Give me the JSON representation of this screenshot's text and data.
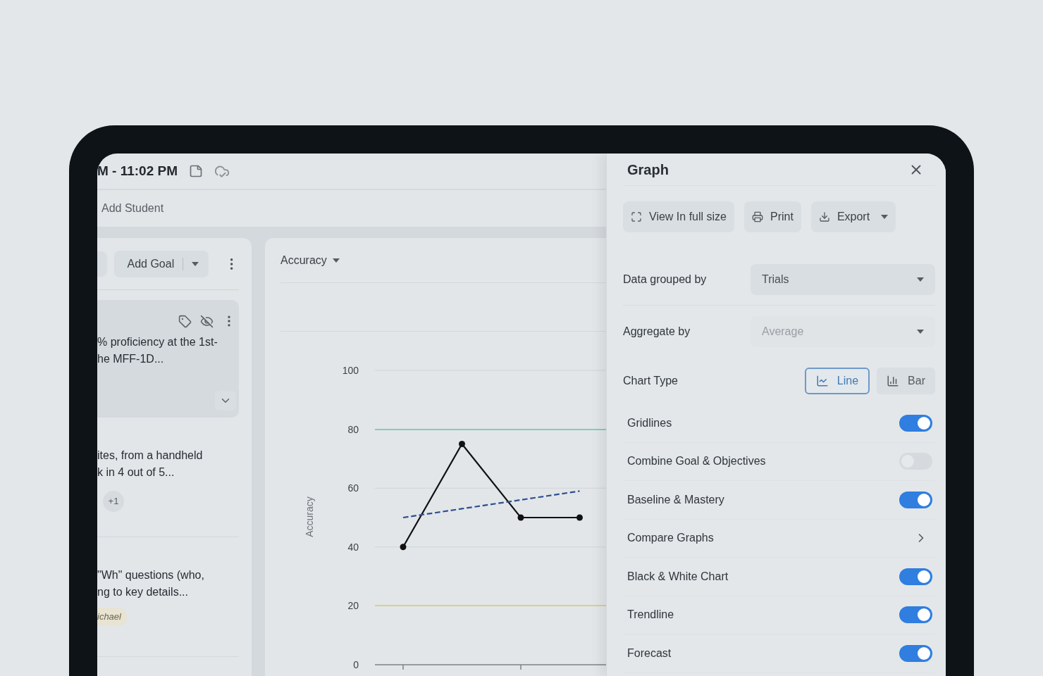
{
  "top_bar": {
    "time": "M - 11:02 PM"
  },
  "sub_bar": {
    "add_student": "Add Student"
  },
  "goals_panel": {
    "add_goal": "Add Goal",
    "goals": [
      {
        "lines": [
          "% proficiency at the 1st-",
          "he MFF-1D..."
        ],
        "selected": true
      },
      {
        "lines": [
          "ites, from a handheld",
          "k in 4 out of 5..."
        ],
        "selected": false,
        "chip": {
          "text": "+1",
          "kind": "count"
        }
      },
      {
        "lines": [
          "\"Wh\" questions (who,",
          "ng to key details..."
        ],
        "selected": false,
        "chip": {
          "text": "ichael",
          "kind": "name"
        }
      }
    ]
  },
  "chart": {
    "metric": "Accuracy",
    "chart_data": {
      "type": "line",
      "ylabel": "Accuracy",
      "ylim": [
        0,
        100
      ],
      "yticks": [
        0,
        20,
        40,
        60,
        80,
        100
      ],
      "series": [
        {
          "color": "#111111",
          "values": [
            40,
            75,
            50,
            50
          ],
          "marker": "circle"
        },
        {
          "color": "#2f4f8f",
          "values": [
            50,
            53,
            56,
            59
          ],
          "line_style": "dashed"
        }
      ],
      "ref_lines": [
        {
          "axis": "y",
          "value": 80,
          "color": "#86cdb6"
        },
        {
          "axis": "y",
          "value": 20,
          "color": "#d9cf8e"
        }
      ]
    }
  },
  "graph_panel": {
    "title": "Graph",
    "actions": [
      {
        "label": "View In full size",
        "kind": "expand"
      },
      {
        "label": "Print",
        "kind": "print"
      },
      {
        "label": "Export",
        "kind": "export"
      }
    ],
    "selects": [
      {
        "label": "Data grouped by",
        "value": "Trials",
        "disabled": false
      },
      {
        "label": "Aggregate by",
        "value": "Average",
        "disabled": true
      }
    ],
    "chart_type": {
      "label": "Chart Type",
      "options": [
        {
          "label": "Line",
          "kind": "line",
          "selected": true
        },
        {
          "label": "Bar",
          "kind": "bar",
          "selected": false
        }
      ]
    },
    "options": [
      {
        "label": "Gridlines",
        "kind": "toggle",
        "on": true
      },
      {
        "label": "Combine Goal & Objectives",
        "kind": "toggle",
        "on": false
      },
      {
        "label": "Baseline & Mastery",
        "kind": "toggle",
        "on": true
      },
      {
        "label": "Compare Graphs",
        "kind": "link"
      },
      {
        "label": "Black & White Chart",
        "kind": "toggle",
        "on": true
      },
      {
        "label": "Trendline",
        "kind": "toggle",
        "on": true
      },
      {
        "label": "Forecast",
        "kind": "toggle",
        "on": true
      }
    ]
  }
}
